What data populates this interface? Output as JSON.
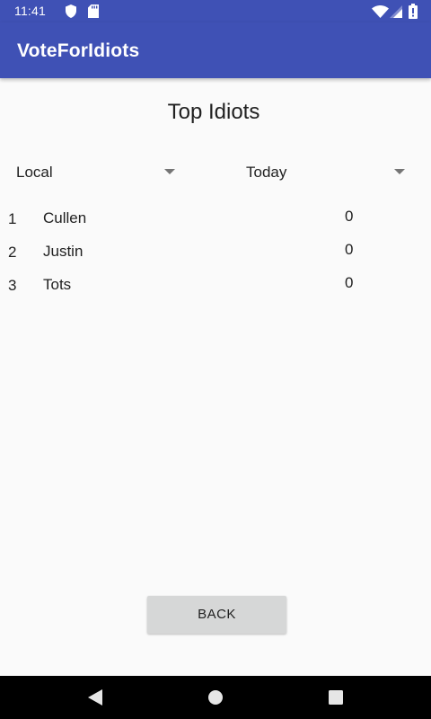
{
  "status_bar": {
    "time": "11:41",
    "icons": [
      "shield-icon",
      "sd-card-icon",
      "wifi-icon",
      "cell-signal-icon",
      "battery-icon"
    ]
  },
  "app": {
    "title": "VoteForIdiots",
    "primary_color": "#3f51b5"
  },
  "page": {
    "title": "Top Idiots"
  },
  "filters": {
    "scope_selected": "Local",
    "period_selected": "Today"
  },
  "rankings": [
    {
      "rank": "1",
      "name": "Cullen",
      "score": "0"
    },
    {
      "rank": "2",
      "name": "Justin",
      "score": "0"
    },
    {
      "rank": "3",
      "name": "Tots",
      "score": "0"
    }
  ],
  "actions": {
    "back_label": "BACK"
  },
  "nav_bar": {
    "icons": [
      "back-triangle-icon",
      "home-circle-icon",
      "recents-square-icon"
    ]
  }
}
